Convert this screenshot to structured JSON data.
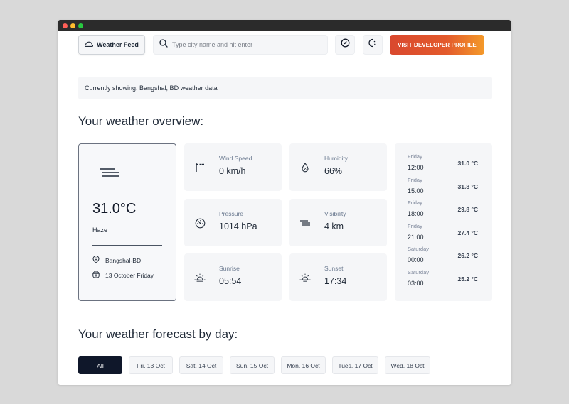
{
  "window": {
    "controls": [
      "close",
      "minimize",
      "maximize"
    ]
  },
  "header": {
    "brand_label": "Weather Feed",
    "brand_icon": "cloud-icon",
    "search_placeholder": "Type city name and hit enter",
    "search_value": "",
    "compass_icon": "compass-icon",
    "theme_icon": "moon-stars-icon",
    "cta_label": "VISIT DEVELOPER PROFILE"
  },
  "notice": {
    "text": "Currently showing: Bangshal, BD weather data"
  },
  "overview": {
    "title": "Your weather overview:",
    "current": {
      "icon": "haze-icon",
      "temperature": "31.0°C",
      "condition": "Haze",
      "location": "Bangshal-BD",
      "date": "13 October Friday"
    },
    "stats": [
      {
        "label": "Wind Speed",
        "value": "0 km/h",
        "icon": "windsock-icon"
      },
      {
        "label": "Humidity",
        "value": "66%",
        "icon": "droplet-icon"
      },
      {
        "label": "Pressure",
        "value": "1014 hPa",
        "icon": "gauge-icon"
      },
      {
        "label": "Visibility",
        "value": "4 km",
        "icon": "fog-icon"
      },
      {
        "label": "Sunrise",
        "value": "05:54",
        "icon": "sunrise-icon"
      },
      {
        "label": "Sunset",
        "value": "17:34",
        "icon": "sunset-icon"
      }
    ],
    "hourly": [
      {
        "day": "Friday",
        "time": "12:00",
        "temp": "31.0 °C"
      },
      {
        "day": "Friday",
        "time": "15:00",
        "temp": "31.8 °C"
      },
      {
        "day": "Friday",
        "time": "18:00",
        "temp": "29.8 °C"
      },
      {
        "day": "Friday",
        "time": "21:00",
        "temp": "27.4 °C"
      },
      {
        "day": "Saturday",
        "time": "00:00",
        "temp": "26.2 °C"
      },
      {
        "day": "Saturday",
        "time": "03:00",
        "temp": "25.2 °C"
      }
    ]
  },
  "forecast": {
    "title": "Your weather forecast by day:",
    "tabs": [
      {
        "label": "All",
        "active": true
      },
      {
        "label": "Fri, 13 Oct",
        "active": false
      },
      {
        "label": "Sat, 14 Oct",
        "active": false
      },
      {
        "label": "Sun, 15 Oct",
        "active": false
      },
      {
        "label": "Mon, 16 Oct",
        "active": false
      },
      {
        "label": "Tues, 17 Oct",
        "active": false
      },
      {
        "label": "Wed, 18 Oct",
        "active": false
      }
    ]
  },
  "colors": {
    "accent_gradient_start": "#d9482e",
    "accent_gradient_end": "#f49a2a",
    "active_tab": "#0f172a",
    "card_bg": "#f5f6f8"
  }
}
